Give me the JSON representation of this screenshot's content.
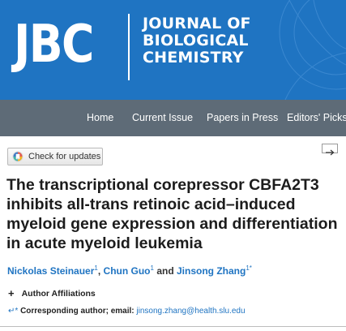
{
  "header": {
    "logo": "JBC",
    "journal_name": [
      "JOURNAL OF",
      "BIOLOGICAL",
      "CHEMISTRY"
    ],
    "background_color": "#1f74c2"
  },
  "nav": {
    "items": [
      "Home",
      "Current Issue",
      "Papers in Press",
      "Editors' Picks"
    ],
    "background_color": "#5e6b77"
  },
  "check_for_updates": {
    "label": "Check for updates",
    "icon": "crossmark-icon"
  },
  "expand_icon": "arrow-right-icon",
  "article": {
    "title_lines": [
      "The transcriptional corepressor CBFA2T3",
      "inhibits all-trans retinoic acid–induced",
      "myeloid gene expression and differentiation",
      "in acute myeloid leukemia"
    ],
    "authors": [
      {
        "name": "Nickolas Steinauer",
        "sup": "1"
      },
      {
        "name": "Chun Guo",
        "sup": "1"
      },
      {
        "name": "Jinsong Zhang",
        "sup": "1*"
      }
    ],
    "author_separator": ",",
    "author_and": "and",
    "affiliations_label": "Author Affiliations",
    "affiliations_toggle": "+",
    "corresponding": {
      "mark": "↵*",
      "label": "Corresponding author; email:",
      "email": "jinsong.zhang@health.slu.edu"
    }
  },
  "colors": {
    "link": "#1f74c2",
    "title": "#1c1c1c"
  }
}
